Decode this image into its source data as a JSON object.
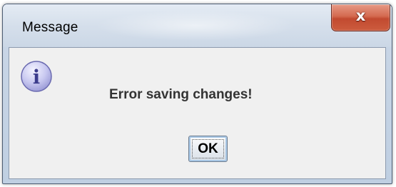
{
  "window": {
    "title": "Message"
  },
  "titlebar": {
    "close_icon": "close-icon",
    "close_glyph": "x"
  },
  "dialog": {
    "icon": "info-icon",
    "icon_glyph": "i",
    "message": "Error saving changes!",
    "ok_label": "OK"
  },
  "colors": {
    "close_button": "#c9583b",
    "content_background": "#f0f0f0",
    "info_icon_fill": "#c8c8f0",
    "info_icon_glyph": "#3c3c8c"
  }
}
